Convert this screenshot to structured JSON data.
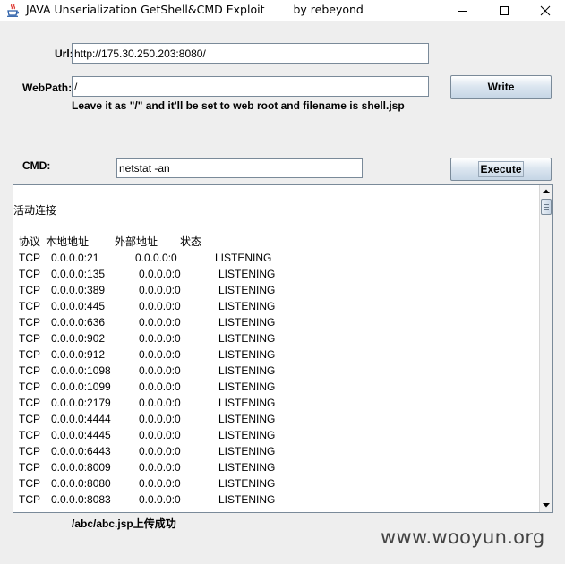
{
  "window": {
    "title": "JAVA Unserialization GetShell&CMD Exploit",
    "author": "by rebeyond"
  },
  "form": {
    "url_label": "Url:",
    "url_value": "http://175.30.250.203:8080/",
    "webpath_label": "WebPath:",
    "webpath_value": "/",
    "write_label": "Write",
    "hint": "Leave it as \"/\" and it'll be set to web root and filename is shell.jsp",
    "cmd_label": "CMD:",
    "cmd_value": "netstat -an",
    "execute_label": "Execute"
  },
  "output": {
    "heading": "活动连接",
    "columns": {
      "proto": "协议",
      "local": "本地地址",
      "foreign": "外部地址",
      "state": "状态"
    },
    "rows": [
      {
        "proto": "TCP",
        "local": "0.0.0.0:21",
        "foreign": "0.0.0.0:0",
        "state": "LISTENING"
      },
      {
        "proto": "TCP",
        "local": "0.0.0.0:135",
        "foreign": "0.0.0.0:0",
        "state": "LISTENING"
      },
      {
        "proto": "TCP",
        "local": "0.0.0.0:389",
        "foreign": "0.0.0.0:0",
        "state": "LISTENING"
      },
      {
        "proto": "TCP",
        "local": "0.0.0.0:445",
        "foreign": "0.0.0.0:0",
        "state": "LISTENING"
      },
      {
        "proto": "TCP",
        "local": "0.0.0.0:636",
        "foreign": "0.0.0.0:0",
        "state": "LISTENING"
      },
      {
        "proto": "TCP",
        "local": "0.0.0.0:902",
        "foreign": "0.0.0.0:0",
        "state": "LISTENING"
      },
      {
        "proto": "TCP",
        "local": "0.0.0.0:912",
        "foreign": "0.0.0.0:0",
        "state": "LISTENING"
      },
      {
        "proto": "TCP",
        "local": "0.0.0.0:1098",
        "foreign": "0.0.0.0:0",
        "state": "LISTENING"
      },
      {
        "proto": "TCP",
        "local": "0.0.0.0:1099",
        "foreign": "0.0.0.0:0",
        "state": "LISTENING"
      },
      {
        "proto": "TCP",
        "local": "0.0.0.0:2179",
        "foreign": "0.0.0.0:0",
        "state": "LISTENING"
      },
      {
        "proto": "TCP",
        "local": "0.0.0.0:4444",
        "foreign": "0.0.0.0:0",
        "state": "LISTENING"
      },
      {
        "proto": "TCP",
        "local": "0.0.0.0:4445",
        "foreign": "0.0.0.0:0",
        "state": "LISTENING"
      },
      {
        "proto": "TCP",
        "local": "0.0.0.0:6443",
        "foreign": "0.0.0.0:0",
        "state": "LISTENING"
      },
      {
        "proto": "TCP",
        "local": "0.0.0.0:8009",
        "foreign": "0.0.0.0:0",
        "state": "LISTENING"
      },
      {
        "proto": "TCP",
        "local": "0.0.0.0:8080",
        "foreign": "0.0.0.0:0",
        "state": "LISTENING"
      },
      {
        "proto": "TCP",
        "local": "0.0.0.0:8083",
        "foreign": "0.0.0.0:0",
        "state": "LISTENING"
      }
    ]
  },
  "status": "/abc/abc.jsp上传成功",
  "watermark": "www.wooyun.org"
}
